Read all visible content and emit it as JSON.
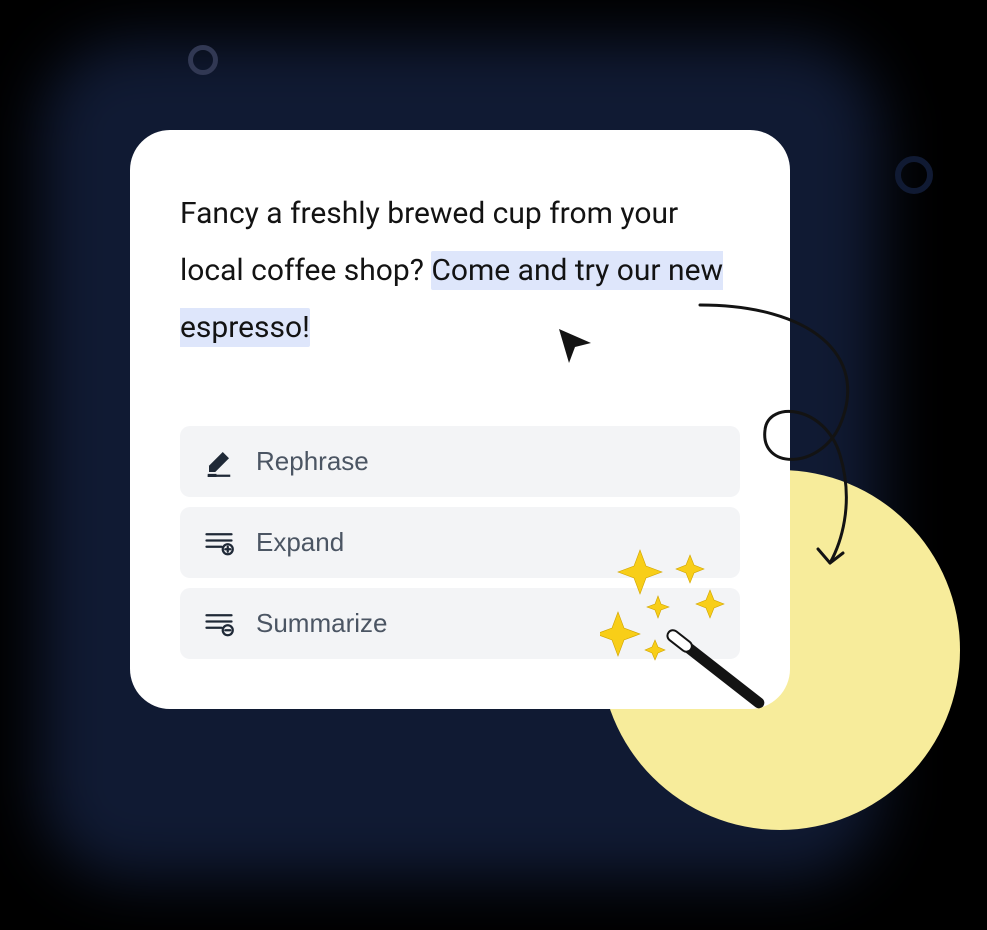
{
  "text": {
    "plain": "Fancy a freshly brewed cup from your local coffee shop? ",
    "highlighted": "Come and try our new espresso!"
  },
  "options": [
    {
      "label": "Rephrase",
      "icon": "edit-icon"
    },
    {
      "label": "Expand",
      "icon": "expand-icon"
    },
    {
      "label": "Summarize",
      "icon": "summarize-icon"
    }
  ],
  "colors": {
    "highlight": "#dee6fb",
    "optionBg": "#f3f4f6",
    "yellow": "#f7ec9b",
    "darkBack": "#101a33",
    "sparkle": "#f8ce18"
  }
}
